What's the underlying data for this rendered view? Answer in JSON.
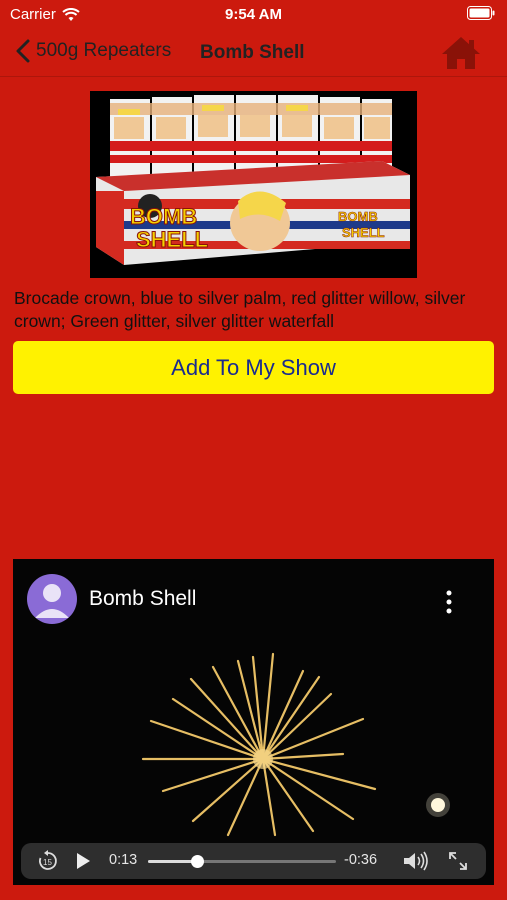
{
  "status_bar": {
    "carrier": "Carrier",
    "time": "9:54 AM"
  },
  "nav": {
    "back_label": "500g Repeaters",
    "title": "Bomb Shell"
  },
  "product": {
    "description": "Brocade crown, blue to silver palm, red glitter willow, silver crown; Green glitter, silver glitter waterfall",
    "add_button_label": "Add To My Show",
    "box_text_line1": "BOMB",
    "box_text_line2": "SHELL"
  },
  "video": {
    "title": "Bomb Shell",
    "elapsed": "0:13",
    "remaining": "-0:36",
    "progress": 0.26
  },
  "colors": {
    "background": "#cc1a0e",
    "button": "#fff200",
    "button_text": "#1a2b8f",
    "home_icon": "#8a1208"
  }
}
